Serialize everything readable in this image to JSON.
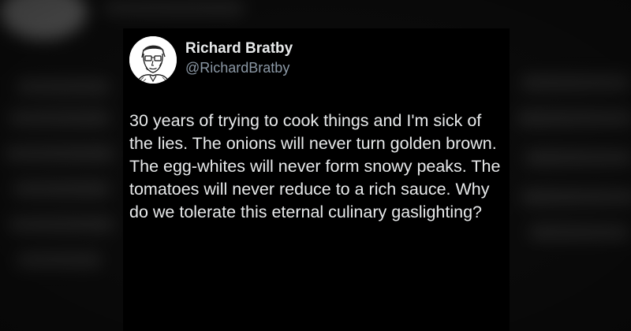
{
  "tweet": {
    "display_name": "Richard Bratby",
    "handle": "@RichardBratby",
    "text": "30 years of trying to cook things and I'm sick of the lies. The onions will never turn golden brown. The egg-whites will never form snowy peaks. The tomatoes will never reduce to a rich sauce. Why do we tolerate this eternal culinary gaslighting?",
    "avatar_icon": "sketch-portrait-icon"
  },
  "colors": {
    "card_background": "#000000",
    "name_text": "#e7e9ea",
    "handle_text": "#8b98a5",
    "body_text": "#e7e9ea"
  }
}
